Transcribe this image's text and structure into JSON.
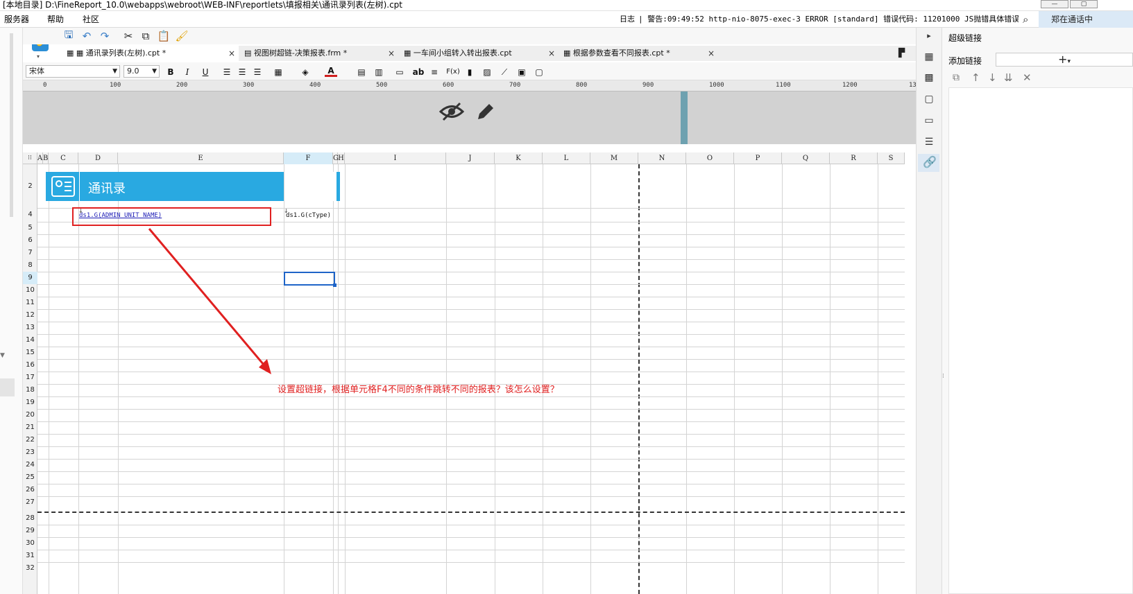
{
  "window": {
    "title_path": "[本地目录]    D:\\FineReport_10.0\\webapps\\webroot\\WEB-INF\\reportlets\\填报相关\\通讯录列表(左树).cpt",
    "btn_min": "—",
    "btn_max": "▢"
  },
  "menu": {
    "items": [
      "服务器",
      "帮助",
      "社区"
    ]
  },
  "status": {
    "log": "日志",
    "warning": "| 警告:09:49:52 http-nio-8075-exec-3 ERROR [standard] 错误代码: 11201000 JS抛错具体错误: $(...",
    "user": "郑在通话中"
  },
  "tabs": [
    {
      "label": "通讯录列表(左树).cpt *",
      "close": "×"
    },
    {
      "label": "视图树超链-决策报表.frm *",
      "close": "×"
    },
    {
      "label": "一车间小组转入转出报表.cpt",
      "close": "×"
    },
    {
      "label": "根据参数查看不同报表.cpt *",
      "close": "×"
    }
  ],
  "format": {
    "font": "宋体",
    "size": "9.0",
    "bold": "B",
    "italic": "I",
    "underline": "U",
    "ab": "ab",
    "fx": "F(x)"
  },
  "ruler": [
    "0",
    "100",
    "200",
    "300",
    "400",
    "500",
    "600",
    "700",
    "800",
    "900",
    "1000",
    "1100",
    "1200",
    "13"
  ],
  "grid": {
    "columns": [
      "A",
      "B",
      "C",
      "D",
      "E",
      "F",
      "G",
      "H",
      "I",
      "J",
      "K",
      "L",
      "M",
      "N",
      "O",
      "P",
      "Q",
      "R",
      "S"
    ],
    "rows": [
      "2",
      "4",
      "5",
      "6",
      "7",
      "8",
      "9",
      "10",
      "11",
      "12",
      "13",
      "14",
      "15",
      "16",
      "17",
      "18",
      "19",
      "20",
      "21",
      "22",
      "23",
      "24",
      "25",
      "26",
      "27",
      "28",
      "29",
      "30",
      "31",
      "32"
    ],
    "selected_column": "F",
    "selected_row": "9",
    "title": "通讯录",
    "d4": "ds1.G(ADMIN_UNIT_NAME)",
    "f4": "ds1.G(cType)"
  },
  "annotation": "设置超链接，根据单元格F4不同的条件跳转不同的报表？该怎么设置？",
  "right_panel": {
    "title": "超级链接",
    "add_label": "添加链接",
    "add_button": "+"
  },
  "colors": {
    "accent": "#29a9e1",
    "annotation": "#e02020",
    "selection": "#1e64c8"
  }
}
